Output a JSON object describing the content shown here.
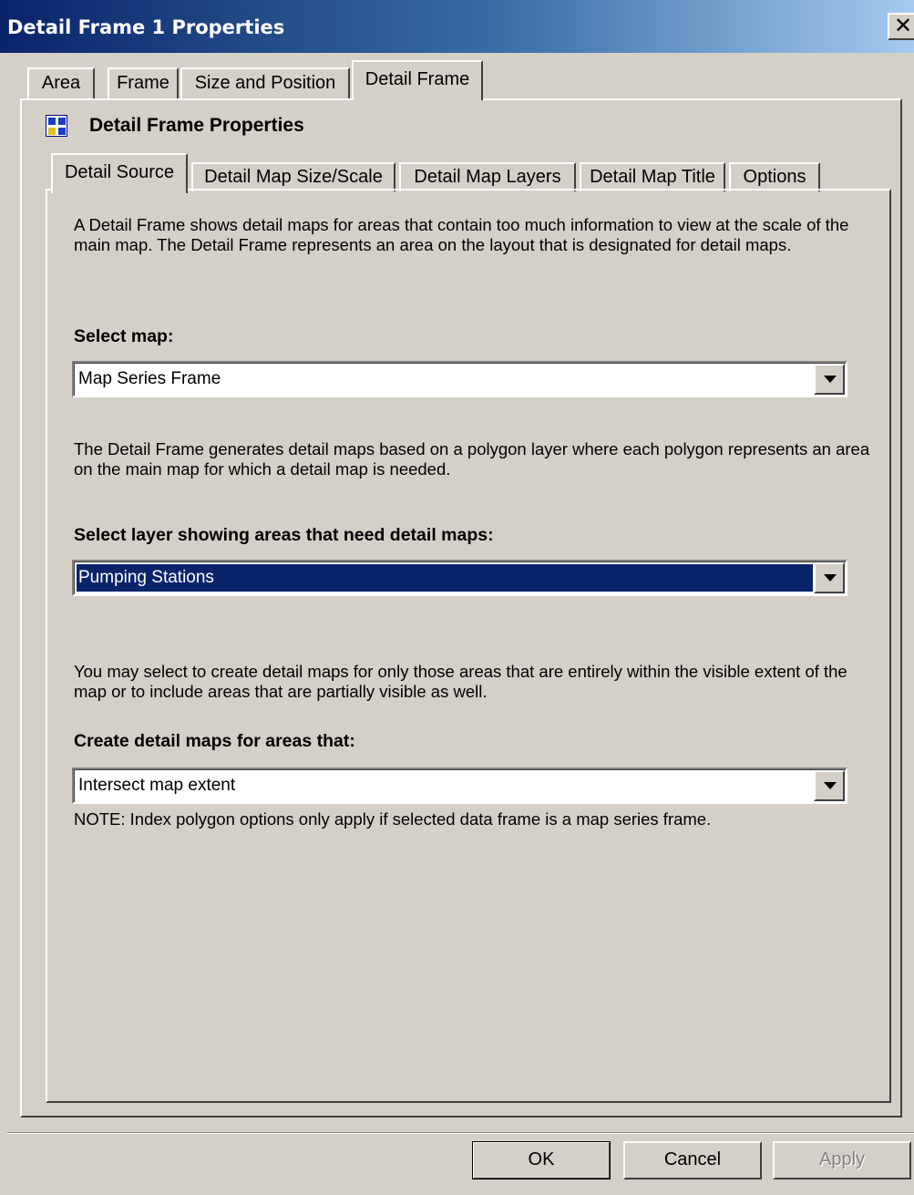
{
  "window": {
    "title": "Detail Frame 1 Properties",
    "close_glyph": "✕"
  },
  "outer_tabs": [
    {
      "label": "Area",
      "active": false
    },
    {
      "label": "Frame",
      "active": false
    },
    {
      "label": "Size and Position",
      "active": false
    },
    {
      "label": "Detail Frame",
      "active": true
    }
  ],
  "panel": {
    "icon": "grid-map-icon",
    "title": "Detail Frame Properties"
  },
  "inner_tabs": [
    {
      "label": "Detail Source",
      "active": true
    },
    {
      "label": "Detail Map Size/Scale",
      "active": false
    },
    {
      "label": "Detail Map Layers",
      "active": false
    },
    {
      "label": "Detail Map Title",
      "active": false
    },
    {
      "label": "Options",
      "active": false
    }
  ],
  "detail_source": {
    "intro": "A Detail Frame shows detail maps for areas that contain too much information to view at the scale of the main map.  The Detail Frame represents an area on the layout that is designated for detail maps.",
    "select_map_label": "Select map:",
    "select_map_value": "Map Series Frame",
    "polygon_text": "The Detail Frame generates detail maps based on a polygon layer where each polygon represents an area on the main map for which a detail map is needed.",
    "select_layer_label": "Select layer showing areas that need detail maps:",
    "select_layer_value": "Pumping Stations",
    "extent_text": "You may select to create detail maps for only those areas that are entirely within the visible extent of the map or to include areas that are partially visible as well.",
    "create_label": "Create detail maps for areas that:",
    "create_value": "Intersect map extent",
    "note": "NOTE: Index polygon options only apply if selected data frame is a map series frame."
  },
  "buttons": {
    "ok": "OK",
    "cancel": "Cancel",
    "apply": "Apply"
  },
  "colors": {
    "titlebar_start": "#0a246a",
    "titlebar_end": "#a6caf0",
    "dialog_bg": "#d4d0c8",
    "selection": "#0a246a"
  }
}
